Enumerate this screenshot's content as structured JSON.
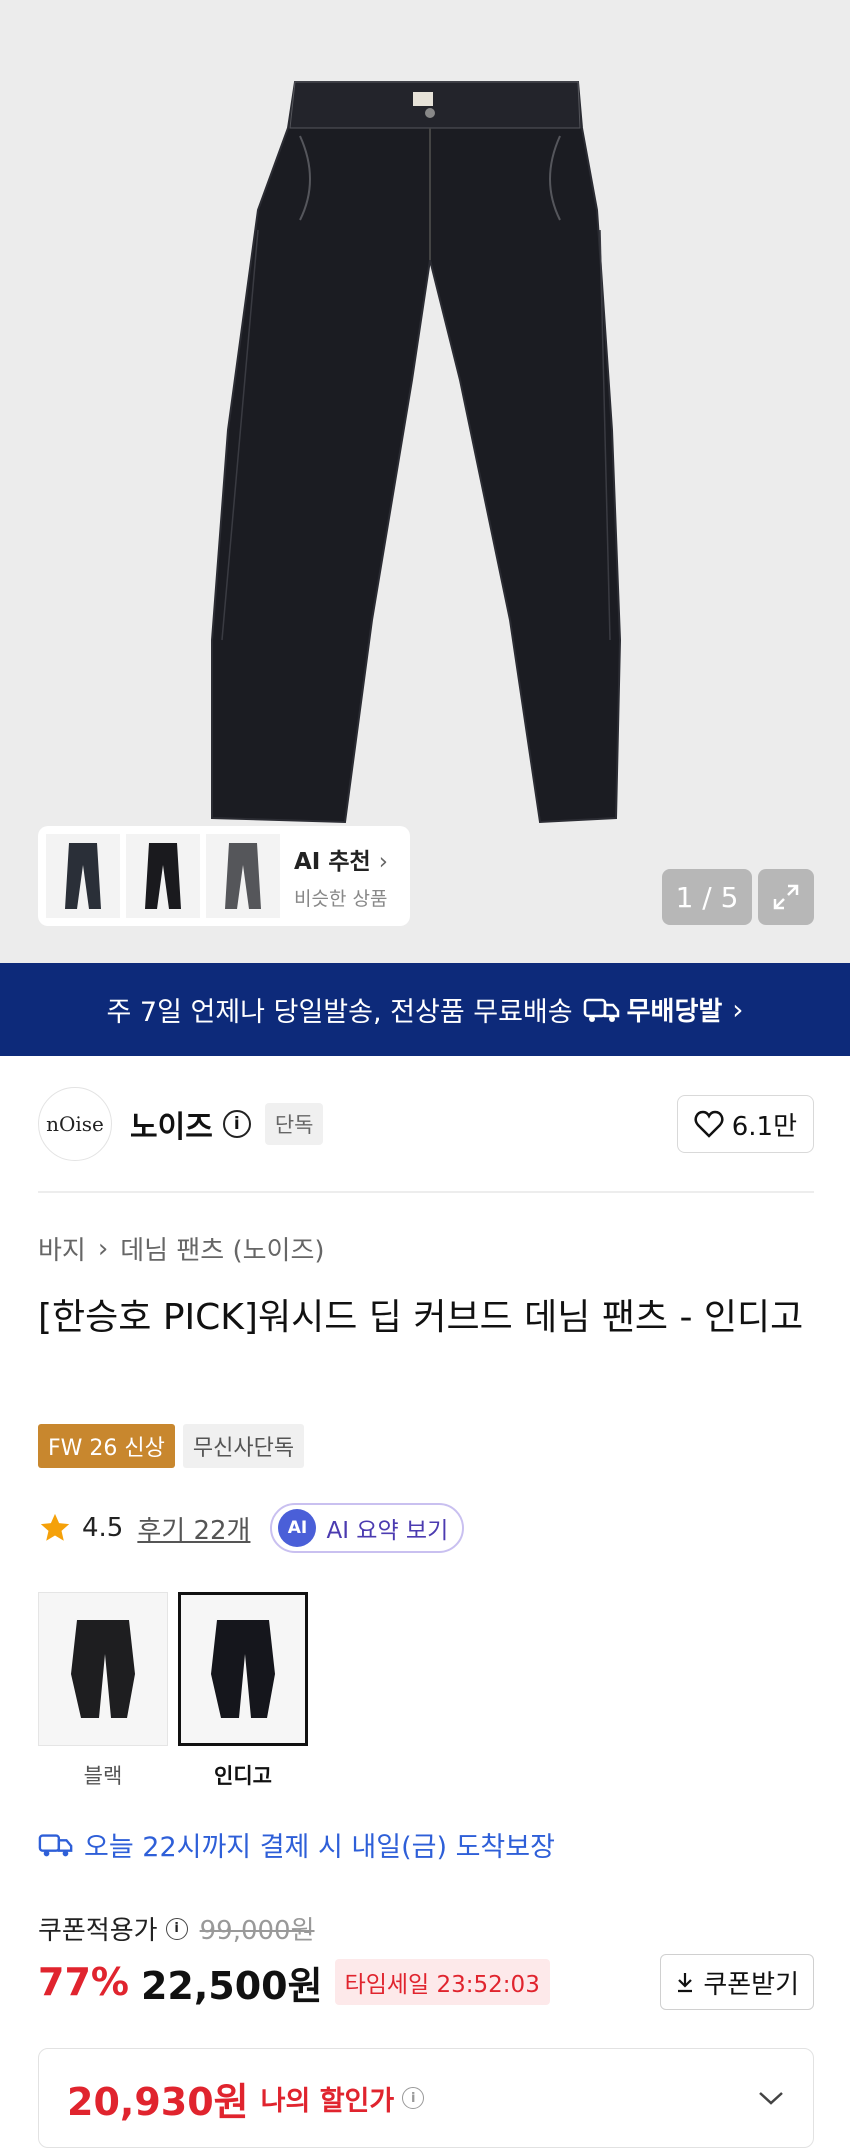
{
  "gallery": {
    "ai_rec_title": "AI 추천",
    "ai_rec_subtitle": "비슷한 상품",
    "counter": "1 / 5"
  },
  "banner": {
    "text": "주 7일 언제나 당일발송, 전상품 무료배송",
    "brand": "무배당발",
    "bg_color": "#0d2a7a"
  },
  "brand": {
    "logo_text": "nOise",
    "name": "노이즈",
    "tag": "단독",
    "likes": "6.1만"
  },
  "breadcrumb": {
    "category": "바지",
    "subcategory": "데님 팬츠 (노이즈)"
  },
  "product": {
    "title": "[한승호 PICK]워시드 딥 커브드 데님 팬츠 - 인디고",
    "badges": [
      "FW 26 신상",
      "무신사단독"
    ],
    "rating": "4.5",
    "reviews": "후기 22개",
    "ai_badge": "AI",
    "ai_summary": "AI 요약 보기"
  },
  "colors": {
    "options": [
      {
        "label": "블랙",
        "selected": false
      },
      {
        "label": "인디고",
        "selected": true
      }
    ]
  },
  "delivery": {
    "text": "오늘 22시까지 결제 시 내일(금) 도착보장"
  },
  "pricing": {
    "coupon_price_label": "쿠폰적용가",
    "original_price": "99,000원",
    "discount": "77%",
    "price": "22,500원",
    "timesale": "타임세일 23:52:03",
    "coupon_button": "쿠폰받기",
    "my_price": "20,930원",
    "my_price_label": "나의 할인가",
    "accent_color": "#e0242e"
  }
}
